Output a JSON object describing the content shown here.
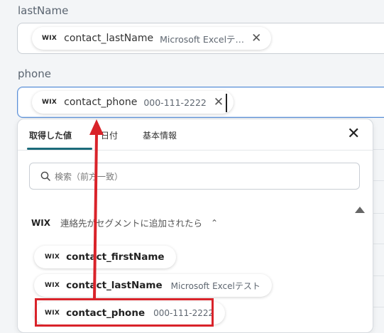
{
  "fields": {
    "lastname": {
      "label": "lastName",
      "chip": {
        "badge": "WIX",
        "name": "contact_lastName",
        "sub": "Microsoft Excelテ…",
        "remove": "✕"
      }
    },
    "phone": {
      "label": "phone",
      "chip": {
        "badge": "WIX",
        "name": "contact_phone",
        "sub": "000-111-2222",
        "remove": "✕"
      }
    }
  },
  "dropdown": {
    "tabs": [
      "取得した値",
      "日付",
      "基本情報"
    ],
    "active_tab": 0,
    "close": "✕",
    "search": {
      "placeholder": "検索（前方一致）"
    },
    "group": {
      "badge": "WIX",
      "title": "連絡先がセグメントに追加されたら",
      "chevron": "⌃"
    },
    "options": [
      {
        "badge": "WIX",
        "name": "contact_firstName",
        "sub": ""
      },
      {
        "badge": "WIX",
        "name": "contact_lastName",
        "sub": "Microsoft Excelテスト"
      },
      {
        "badge": "WIX",
        "name": "contact_phone",
        "sub": "000-111-2222"
      }
    ]
  },
  "colors": {
    "annotation": "#d9232a",
    "accent_tab": "#1c6b7a",
    "focus_border": "#5b8fd6"
  }
}
